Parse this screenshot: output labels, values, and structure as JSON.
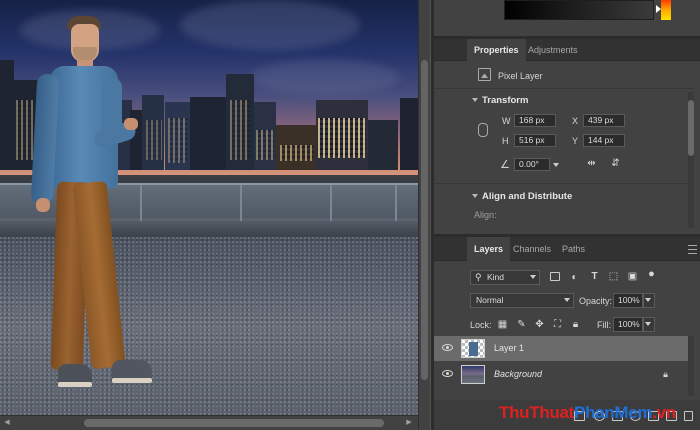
{
  "properties_panel": {
    "tabs": [
      "Properties",
      "Adjustments"
    ],
    "active_tab": "Properties",
    "layer_kind": "Pixel Layer",
    "transform": {
      "heading": "Transform",
      "w": "168 px",
      "x": "439 px",
      "h": "516 px",
      "y": "144 px",
      "angle": "0.00°"
    },
    "align": {
      "heading": "Align and Distribute",
      "align_label": "Align:"
    }
  },
  "layers_panel": {
    "tabs": [
      "Layers",
      "Channels",
      "Paths"
    ],
    "active_tab": "Layers",
    "filter_kind": "Kind",
    "blend_mode": "Normal",
    "opacity_label": "Opacity:",
    "opacity_value": "100%",
    "lock_label": "Lock:",
    "fill_label": "Fill:",
    "fill_value": "100%",
    "layers": [
      {
        "name": "Layer 1",
        "selected": true,
        "visible": true,
        "locked": false
      },
      {
        "name": "Background",
        "selected": false,
        "visible": true,
        "locked": true
      }
    ]
  },
  "watermark": {
    "part1": "ThuThuat",
    "part2": "PhanMem",
    "part3": ".vn",
    "colors": {
      "part1": "#e02020",
      "part2": "#1e6fd9",
      "part3": "#e02020"
    }
  },
  "colors": {
    "panel_bg": "#424242",
    "tab_bar": "#323232",
    "selected_layer": "#6b6b6b",
    "canvas_gutter": "#535353"
  }
}
